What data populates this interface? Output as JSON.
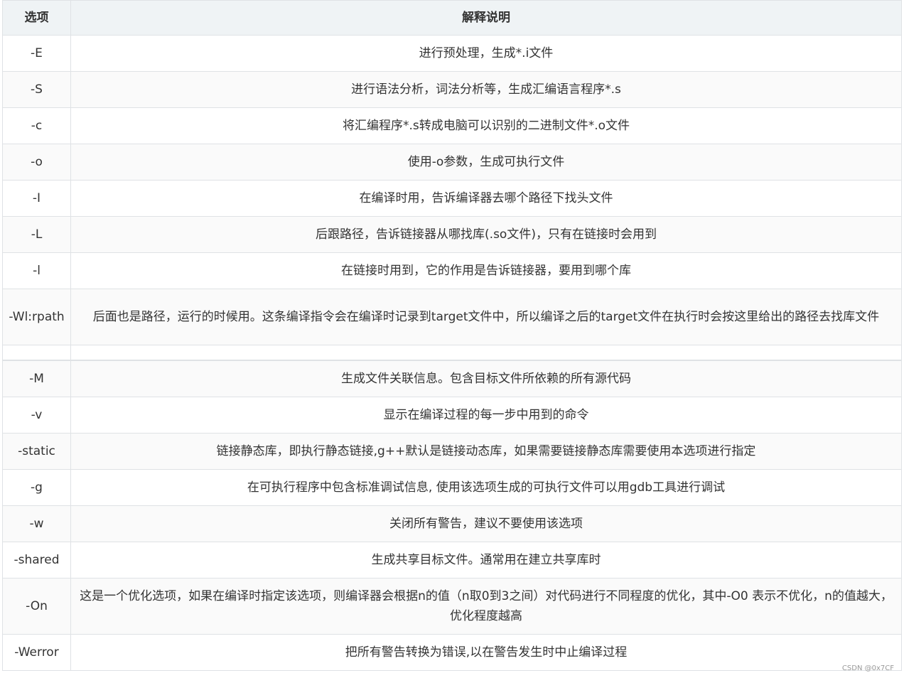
{
  "table": {
    "headers": [
      "选项",
      "解释说明"
    ],
    "rows": [
      {
        "option": "-E",
        "desc": "进行预处理，生成*.i文件"
      },
      {
        "option": "-S",
        "desc": "进行语法分析，词法分析等，生成汇编语言程序*.s"
      },
      {
        "option": "-c",
        "desc": "将汇编程序*.s转成电脑可以识别的二进制文件*.o文件"
      },
      {
        "option": "-o",
        "desc": "使用-o参数，生成可执行文件"
      },
      {
        "option": "-I",
        "desc": "在编译时用，告诉编译器去哪个路径下找头文件"
      },
      {
        "option": "-L",
        "desc": "后跟路径，告诉链接器从哪找库(.so文件)，只有在链接时会用到"
      },
      {
        "option": "-l",
        "desc": "在链接时用到，它的作用是告诉链接器，要用到哪个库"
      },
      {
        "option": "-Wl:rpath",
        "desc": "后面也是路径，运行的时候用。这条编译指令会在编译时记录到target文件中，所以编译之后的target文件在执行时会按这里给出的路径去找库文件"
      },
      {
        "option": "",
        "desc": ""
      },
      {
        "option": "-M",
        "desc": "生成文件关联信息。包含目标文件所依赖的所有源代码"
      },
      {
        "option": "-v",
        "desc": "显示在编译过程的每一步中用到的命令"
      },
      {
        "option": "-static",
        "desc": "链接静态库，即执行静态链接,g++默认是链接动态库，如果需要链接静态库需要使用本选项进行指定"
      },
      {
        "option": "-g",
        "desc": "在可执行程序中包含标准调试信息, 使用该选项生成的可执行文件可以用gdb工具进行调试"
      },
      {
        "option": "-w",
        "desc": "关闭所有警告，建议不要使用该选项"
      },
      {
        "option": "-shared",
        "desc": "生成共享目标文件。通常用在建立共享库时"
      },
      {
        "option": "-On",
        "desc": "这是一个优化选项，如果在编译时指定该选项，则编译器会根据n的值（n取0到3之间）对代码进行不同程度的优化，其中-O0 表示不优化，n的值越大，优化程度越高"
      },
      {
        "option": "-Werror",
        "desc": "把所有警告转换为错误,以在警告发生时中止编译过程"
      }
    ]
  },
  "watermark": "CSDN @0x7CF"
}
